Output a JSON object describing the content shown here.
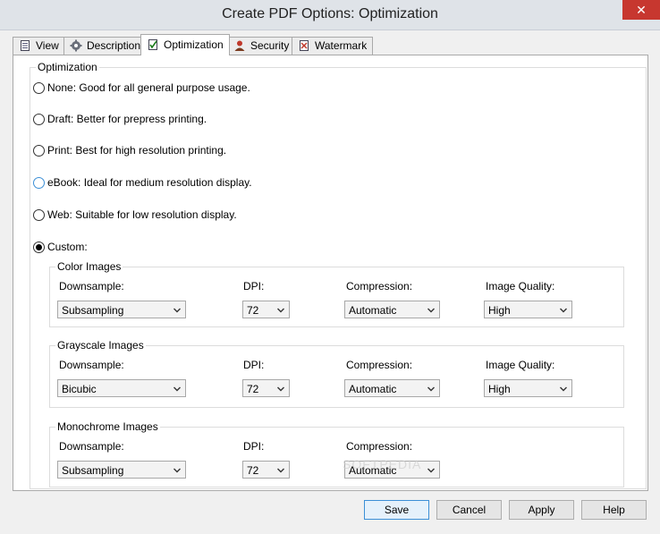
{
  "window": {
    "title": "Create PDF Options: Optimization",
    "close_glyph": "✕"
  },
  "tabs": [
    {
      "label": "View",
      "icon": "document-icon"
    },
    {
      "label": "Description",
      "icon": "gear-icon"
    },
    {
      "label": "Optimization",
      "icon": "checklist-icon",
      "active": true
    },
    {
      "label": "Security",
      "icon": "user-icon"
    },
    {
      "label": "Watermark",
      "icon": "watermark-icon"
    }
  ],
  "optimization": {
    "group_label": "Optimization",
    "options": [
      {
        "label": "None: Good for all general purpose usage.",
        "checked": false
      },
      {
        "label": "Draft: Better for prepress printing.",
        "checked": false
      },
      {
        "label": "Print: Best for high resolution printing.",
        "checked": false
      },
      {
        "label": "eBook: Ideal for medium resolution display.",
        "checked": false,
        "focused": true
      },
      {
        "label": "Web: Suitable for low resolution display.",
        "checked": false
      },
      {
        "label": "Custom:",
        "checked": true
      }
    ]
  },
  "color_images": {
    "label": "Color Images",
    "downsample_label": "Downsample:",
    "downsample_value": "Subsampling",
    "dpi_label": "DPI:",
    "dpi_value": "72",
    "compression_label": "Compression:",
    "compression_value": "Automatic",
    "quality_label": "Image Quality:",
    "quality_value": "High"
  },
  "grayscale_images": {
    "label": "Grayscale Images",
    "downsample_label": "Downsample:",
    "downsample_value": "Bicubic",
    "dpi_label": "DPI:",
    "dpi_value": "72",
    "compression_label": "Compression:",
    "compression_value": "Automatic",
    "quality_label": "Image Quality:",
    "quality_value": "High"
  },
  "monochrome_images": {
    "label": "Monochrome Images",
    "downsample_label": "Downsample:",
    "downsample_value": "Subsampling",
    "dpi_label": "DPI:",
    "dpi_value": "72",
    "compression_label": "Compression:",
    "compression_value": "Automatic"
  },
  "buttons": {
    "save": "Save",
    "cancel": "Cancel",
    "apply": "Apply",
    "help": "Help"
  },
  "watermark_text": "SOFTPEDIA"
}
